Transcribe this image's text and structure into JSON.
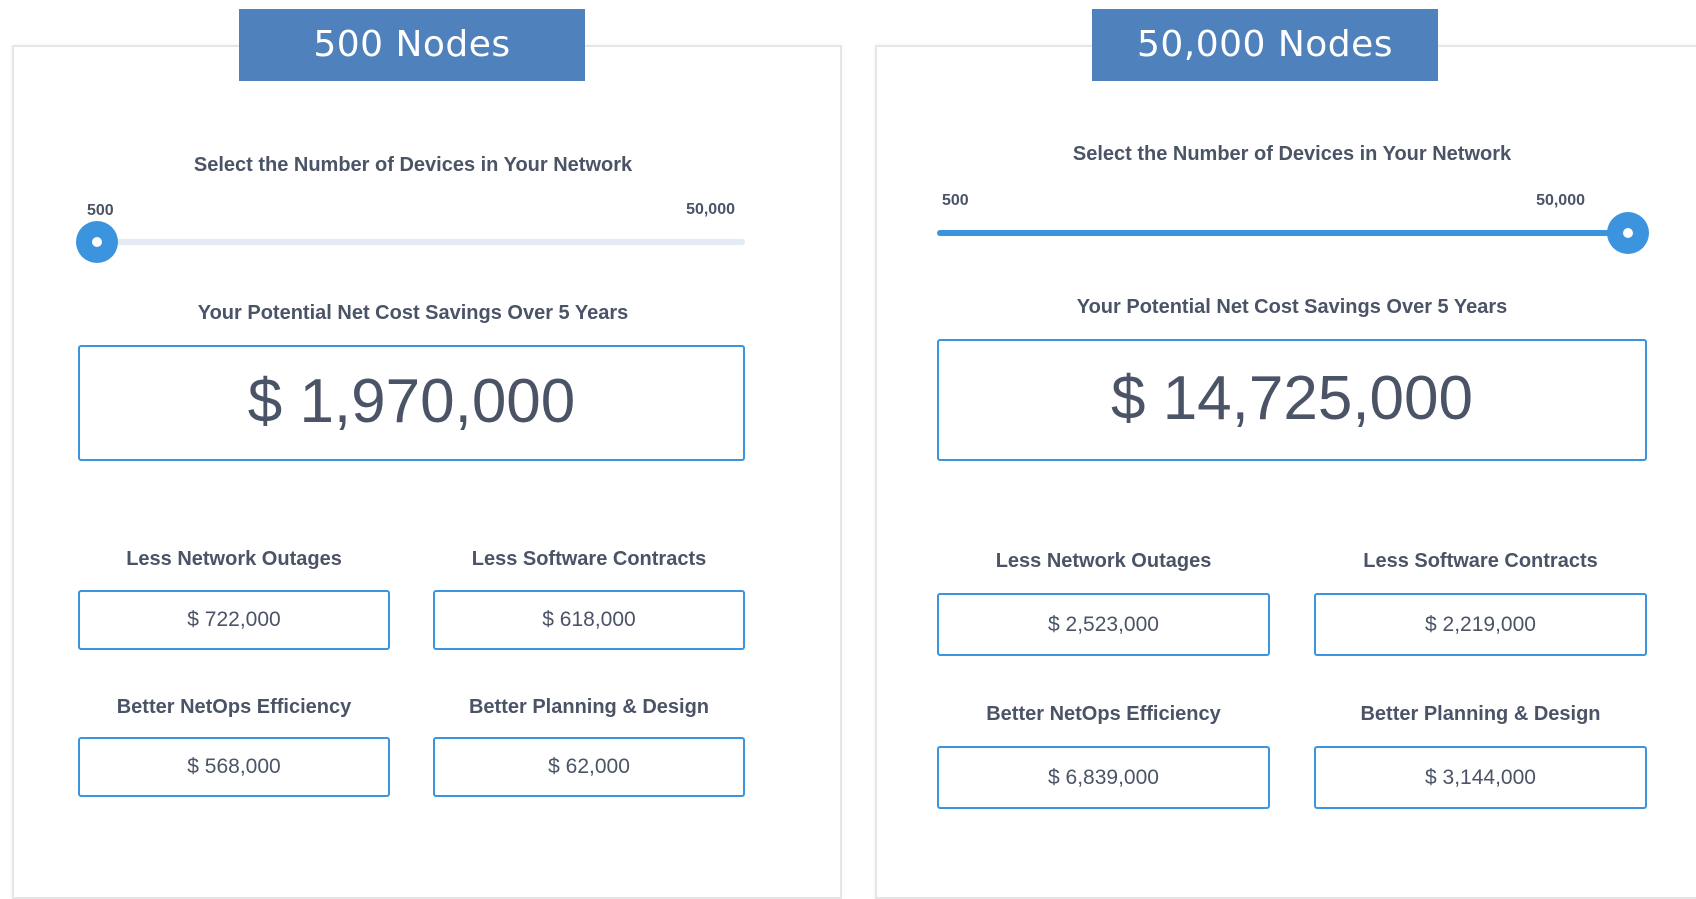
{
  "left": {
    "banner": "500 Nodes",
    "slider_heading": "Select the Number of Devices in Your Network",
    "range_min": "500",
    "range_max": "50,000",
    "slider_fraction": 0,
    "savings_heading": "Your Potential Net Cost Savings Over 5 Years",
    "total_savings": "$ 1,970,000",
    "metrics": [
      {
        "label": "Less Network Outages",
        "value": "$ 722,000"
      },
      {
        "label": "Less Software Contracts",
        "value": "$ 618,000"
      },
      {
        "label": "Better NetOps Efficiency",
        "value": "$ 568,000"
      },
      {
        "label": "Better Planning & Design",
        "value": "$ 62,000"
      }
    ]
  },
  "right": {
    "banner": "50,000 Nodes",
    "slider_heading": "Select the Number of Devices in Your Network",
    "range_min": "500",
    "range_max": "50,000",
    "slider_fraction": 1,
    "savings_heading": "Your Potential Net Cost Savings Over 5 Years",
    "total_savings": "$ 14,725,000",
    "metrics": [
      {
        "label": "Less Network Outages",
        "value": "$ 2,523,000"
      },
      {
        "label": "Less Software Contracts",
        "value": "$ 2,219,000"
      },
      {
        "label": "Better NetOps Efficiency",
        "value": "$ 6,839,000"
      },
      {
        "label": "Better Planning & Design",
        "value": "$ 3,144,000"
      }
    ]
  },
  "colors": {
    "banner": "#4f81bd",
    "accent": "#3c93de",
    "text": "#4b5467",
    "track": "#e3eaf3"
  }
}
